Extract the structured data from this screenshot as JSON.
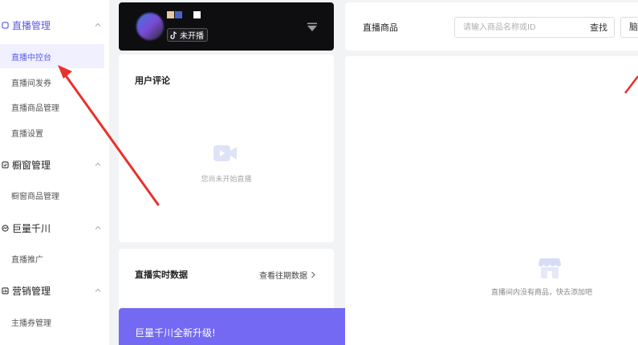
{
  "sidebar": {
    "groups": [
      {
        "title": "直播管理",
        "icon": "live-icon",
        "items": [
          "直播中控台",
          "直播间发券",
          "直播商品管理",
          "直播设置"
        ]
      },
      {
        "title": "橱窗管理",
        "icon": "showcase-icon",
        "items": [
          "橱窗商品管理"
        ]
      },
      {
        "title": "巨量千川",
        "icon": "qianchuan-icon",
        "items": [
          "直播推广"
        ]
      },
      {
        "title": "营销管理",
        "icon": "marketing-icon",
        "items": [
          "主播券管理"
        ]
      }
    ],
    "active_item": "直播中控台"
  },
  "live_card": {
    "status": "未开播"
  },
  "comments": {
    "title": "用户评论",
    "empty_text": "您尚未开始直播"
  },
  "realtime": {
    "title": "直播实时数据",
    "history_link": "查看往期数据"
  },
  "upgrade": {
    "text": "巨量千川全新升级!"
  },
  "products": {
    "title": "直播商品",
    "search_placeholder": "请输入商品名称或ID",
    "search_button": "查找",
    "more_button": "脑",
    "empty_text": "直播间内没有商品，快去添加吧"
  },
  "colors": {
    "accent": "#5b5ce6",
    "banner": "#7469f2",
    "arrow": "#e8322b"
  }
}
